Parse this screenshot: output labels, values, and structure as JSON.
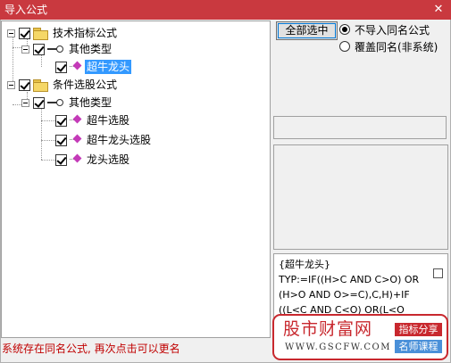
{
  "window": {
    "title": "导入公式",
    "close_glyph": "✕"
  },
  "tree": {
    "nodes": [
      {
        "label": "技术指标公式",
        "checked": true,
        "icon": "folder-icon"
      },
      {
        "label": "其他类型",
        "checked": true,
        "icon": "key-icon"
      },
      {
        "label": "超牛龙头",
        "checked": true,
        "icon": "formula-leaf-icon",
        "selected": true
      },
      {
        "label": "条件选股公式",
        "checked": true,
        "icon": "folder-icon"
      },
      {
        "label": "其他类型",
        "checked": true,
        "icon": "key-icon"
      },
      {
        "label": "超牛选股",
        "checked": true,
        "icon": "formula-leaf-icon"
      },
      {
        "label": "超牛龙头选股",
        "checked": true,
        "icon": "formula-leaf-icon"
      },
      {
        "label": "龙头选股",
        "checked": true,
        "icon": "formula-leaf-icon"
      }
    ]
  },
  "options": {
    "select_all_label": "全部选中",
    "radio_skip_label": "不导入同名公式",
    "radio_overwrite_label": "覆盖同名(非系统)",
    "selected_radio": "radio_skip_label"
  },
  "preview": {
    "lines": [
      "{超牛龙头}",
      "TYP:=IF((H>C AND C>O) OR",
      "(H>O AND O>=C),C,H)+IF",
      "((L<C AND C<O) OR(L<O"
    ]
  },
  "status": {
    "message": "系统存在同名公式, 再次点击可以更名"
  },
  "watermark": {
    "title": "股市财富网",
    "url": "WWW.GSCFW.COM",
    "tag_one": "指标分享",
    "tag_two": "名师课程",
    "accent": "#c8282e",
    "tag_two_color": "#4a90d9"
  },
  "colors": {
    "titlebar": "#c9393f",
    "selection": "#3399ff",
    "status_text": "#c00000"
  }
}
